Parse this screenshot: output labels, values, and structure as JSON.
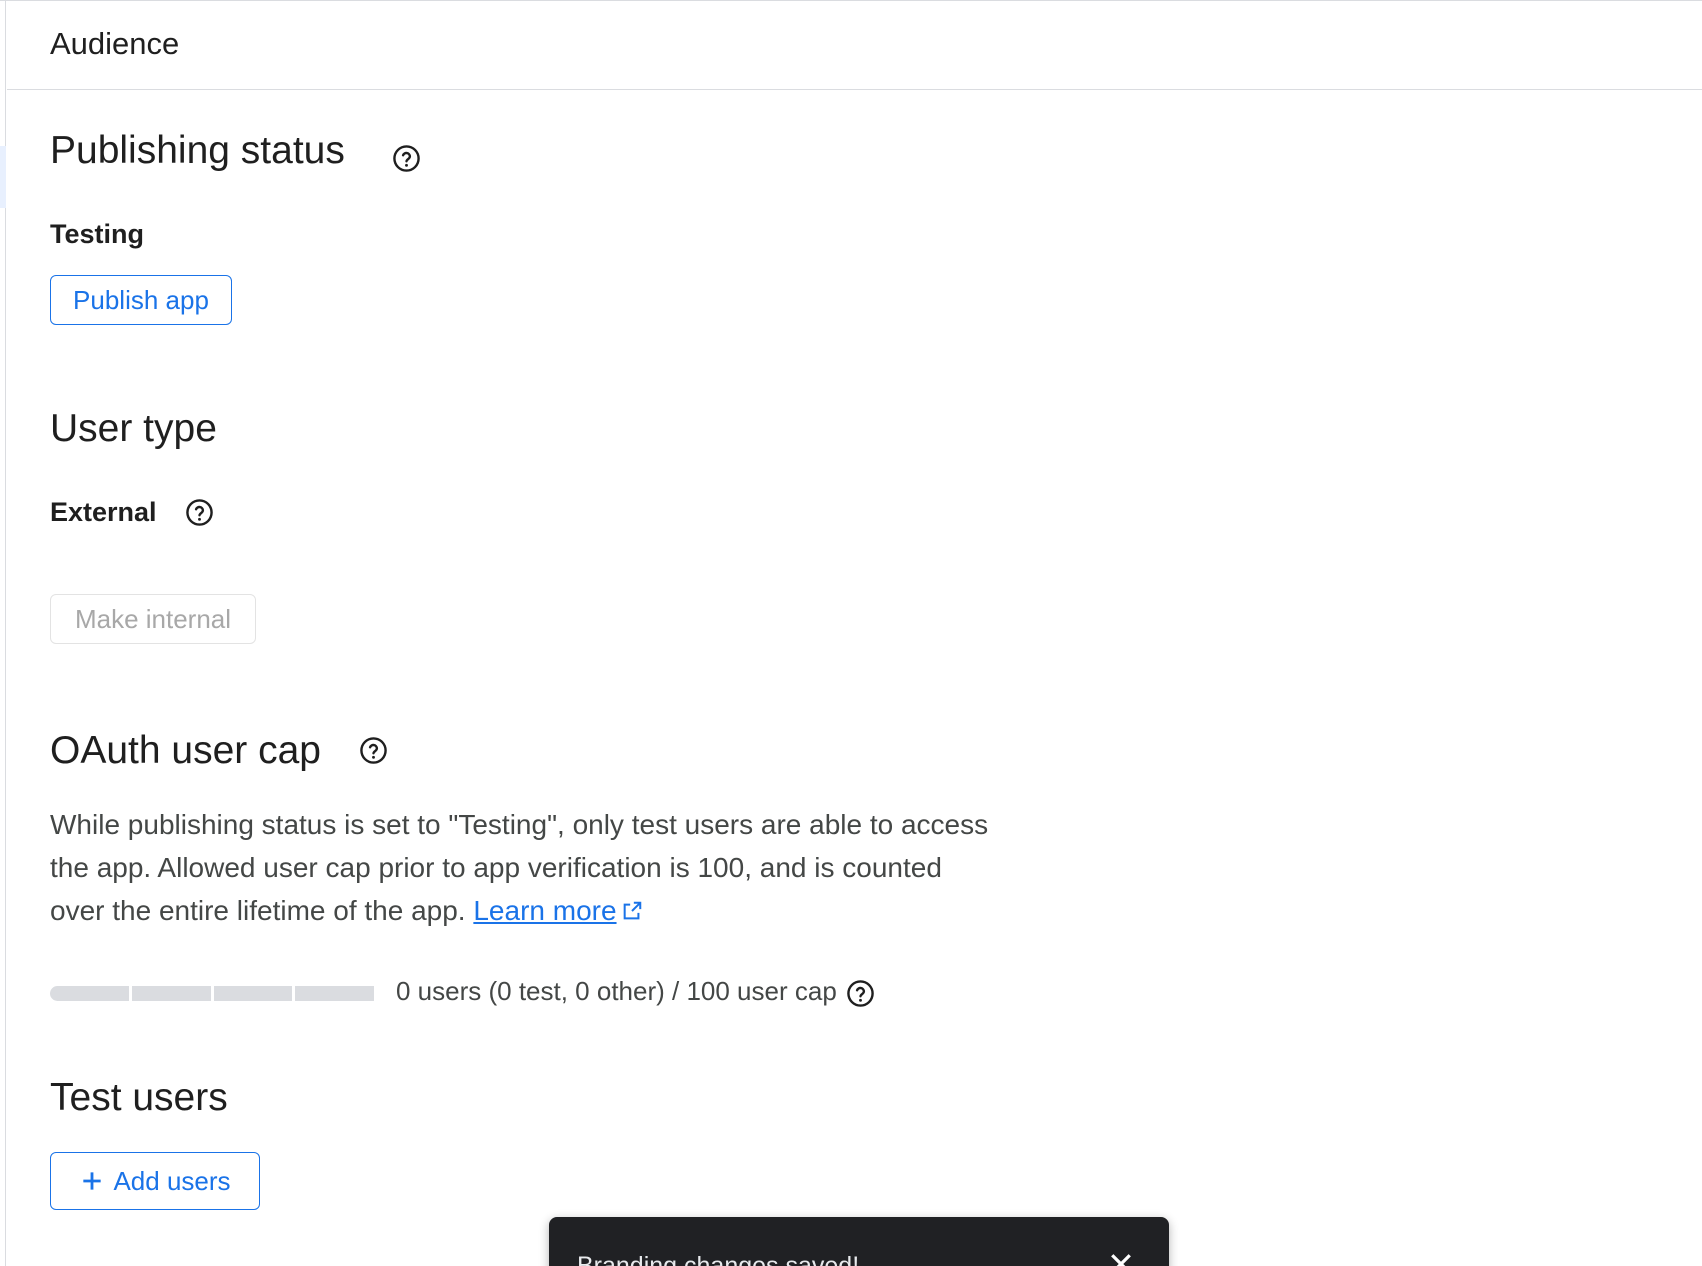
{
  "header": {
    "title": "Audience"
  },
  "publishing_status": {
    "title": "Publishing status",
    "status_label": "Testing",
    "publish_button": "Publish app"
  },
  "user_type": {
    "title": "User type",
    "type_label": "External",
    "make_internal_button": "Make internal"
  },
  "oauth_cap": {
    "title": "OAuth user cap",
    "description": "While publishing status is set to \"Testing\", only test users are able to access the app. Allowed user cap prior to app verification is 100, and is counted over the entire lifetime of the app.",
    "learn_more": "Learn more",
    "usage_text": "0 users (0 test, 0 other) / 100 user cap",
    "usage_fraction": 0
  },
  "test_users": {
    "title": "Test users",
    "add_button": "Add users"
  },
  "snackbar": {
    "message": "Branding changes saved!"
  },
  "icons": {
    "help": "help-circle-icon",
    "external_link": "open-in-new-icon",
    "add": "plus-icon",
    "close": "close-icon"
  },
  "colors": {
    "accent": "#1a73e8",
    "text_primary": "#1f1f1f",
    "text_secondary": "#444746",
    "divider": "#dadce0",
    "snackbar_bg": "#202124"
  }
}
